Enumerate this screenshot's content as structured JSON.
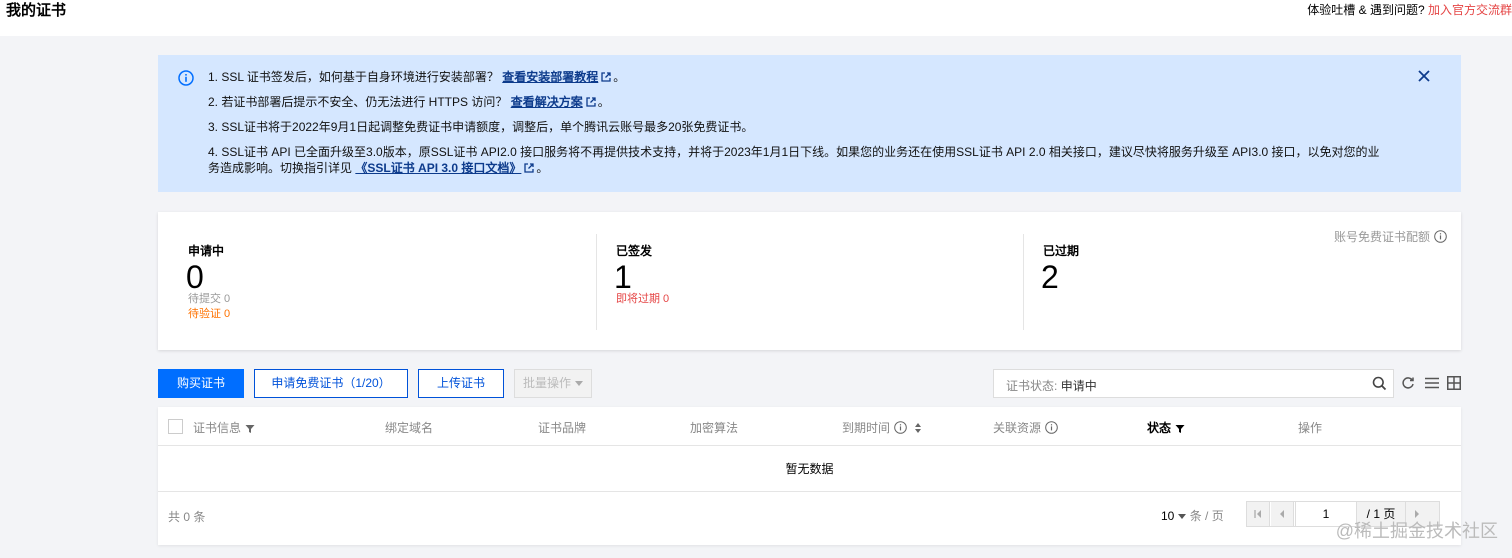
{
  "header": {
    "title": "我的证书",
    "feedback_text": "体验吐槽 & 遇到问题?",
    "feedback_link": "加入官方交流群"
  },
  "notice": {
    "line1_text": "1. SSL 证书签发后，如何基于自身环境进行安装部署？",
    "line1_link": "查看安装部署教程",
    "line2_text": "2. 若证书部署后提示不安全、仍无法进行 HTTPS 访问？",
    "line2_link": "查看解决方案",
    "line3_text": "3. SSL证书将于2022年9月1日起调整免费证书申请额度，调整后，单个腾讯云账号最多20张免费证书。",
    "line4_text": "4. SSL证书 API 已全面升级至3.0版本，原SSL证书 API2.0 接口服务将不再提供技术支持，并将于2023年1月1日下线。如果您的业务还在使用SSL证书 API 2.0 相关接口，建议尽快将服务升级至 API3.0 接口，以免对您的业务造成影响。切换指引详见",
    "line4_link": "《SSL证书 API 3.0 接口文档》",
    "period": "。"
  },
  "stats": {
    "pending": {
      "label": "申请中",
      "count": "0",
      "sub1": "待提交 0",
      "sub2": "待验证 0"
    },
    "issued": {
      "label": "已签发",
      "count": "1",
      "sub1": "即将过期 0"
    },
    "expired": {
      "label": "已过期",
      "count": "2"
    },
    "quota_label": "账号免费证书配额"
  },
  "toolbar": {
    "buy_label": "购买证书",
    "apply_free_label": "申请免费证书（1/20）",
    "upload_label": "上传证书",
    "batch_label": "批量操作"
  },
  "search": {
    "tag_key": "证书状态:",
    "tag_value": "申请中"
  },
  "table": {
    "columns": [
      "证书信息",
      "绑定域名",
      "证书品牌",
      "加密算法",
      "到期时间",
      "关联资源",
      "状态",
      "操作"
    ],
    "empty_text": "暂无数据"
  },
  "pagination": {
    "total_text": "共 0 条",
    "page_size": "10",
    "page_size_unit": "条 / 页",
    "current_page": "1",
    "total_pages": "/ 1 页"
  },
  "watermark": "@稀土掘金技术社区",
  "colors": {
    "primary": "#006eff",
    "notice_bg": "#d5e7ff",
    "warning": "#ff7200",
    "danger": "#e54545"
  }
}
